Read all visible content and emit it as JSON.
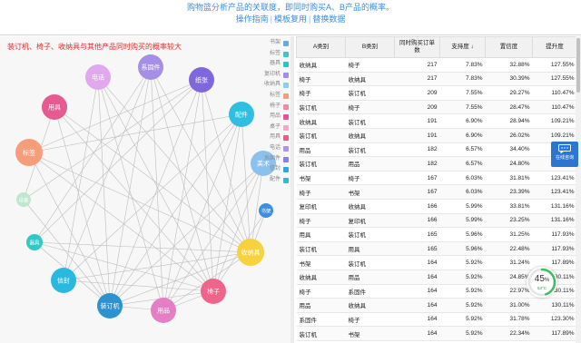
{
  "header": {
    "description": "购物篮分析产品的关联度，即同时购买A、B产品的概率。",
    "links": [
      "操作指南",
      "模板复用",
      "替换数据"
    ]
  },
  "chart": {
    "title": "装订机、椅子、收纳具与其他产品同时购买的概率较大",
    "legend": [
      {
        "label": "书架",
        "color": "#6aa7e8"
      },
      {
        "label": "标签",
        "color": "#3fc6c8"
      },
      {
        "label": "器具",
        "color": "#30c2c9"
      },
      {
        "label": "复印机",
        "color": "#a08ee8"
      },
      {
        "label": "收纳具",
        "color": "#8ad0e8"
      },
      {
        "label": "标签",
        "color": "#f79d7b"
      },
      {
        "label": "椅子",
        "color": "#f08aa0"
      },
      {
        "label": "用品",
        "color": "#e3559b"
      },
      {
        "label": "桌子",
        "color": "#f7a8c8"
      },
      {
        "label": "用具",
        "color": "#e95b8c"
      },
      {
        "label": "电话",
        "color": "#b691e8"
      },
      {
        "label": "系固件",
        "color": "#8a7ee6"
      },
      {
        "label": "信封",
        "color": "#2fa7d9"
      },
      {
        "label": "配件",
        "color": "#3bb5d6"
      }
    ],
    "nodes": [
      {
        "id": "电话",
        "color": "#e1a8ef"
      },
      {
        "id": "系固件",
        "color": "#a58fe6"
      },
      {
        "id": "纸张",
        "color": "#7e68dc"
      },
      {
        "id": "用具",
        "color": "#e55a91"
      },
      {
        "id": "配件",
        "color": "#2fbfe0"
      },
      {
        "id": "标签",
        "color": "#f69d7b"
      },
      {
        "id": "美术",
        "color": "#8cc1ee"
      },
      {
        "id": "设备",
        "color": "#bfe6cf"
      },
      {
        "id": "书架",
        "color": "#3d8ee0"
      },
      {
        "id": "器具",
        "color": "#2fc9c8"
      },
      {
        "id": "收纳具",
        "color": "#f7d23e"
      },
      {
        "id": "信封",
        "color": "#2ab9de"
      },
      {
        "id": "椅子",
        "color": "#f0648a"
      },
      {
        "id": "装订机",
        "color": "#2c93d0"
      },
      {
        "id": "用品",
        "color": "#e67ec6"
      }
    ],
    "links": [
      [
        "装订机",
        "电话"
      ],
      [
        "装订机",
        "系固件"
      ],
      [
        "装订机",
        "纸张"
      ],
      [
        "装订机",
        "配件"
      ],
      [
        "装订机",
        "用具"
      ],
      [
        "装订机",
        "标签"
      ],
      [
        "装订机",
        "美术"
      ],
      [
        "装订机",
        "收纳具"
      ],
      [
        "装订机",
        "椅子"
      ],
      [
        "装订机",
        "用品"
      ],
      [
        "装订机",
        "器具"
      ],
      [
        "装订机",
        "设备"
      ],
      [
        "椅子",
        "电话"
      ],
      [
        "椅子",
        "系固件"
      ],
      [
        "椅子",
        "纸张"
      ],
      [
        "椅子",
        "配件"
      ],
      [
        "椅子",
        "用具"
      ],
      [
        "椅子",
        "标签"
      ],
      [
        "椅子",
        "书架"
      ],
      [
        "椅子",
        "美术"
      ],
      [
        "椅子",
        "器具"
      ],
      [
        "椅子",
        "信封"
      ],
      [
        "椅子",
        "用品"
      ],
      [
        "收纳具",
        "电话"
      ],
      [
        "收纳具",
        "系固件"
      ],
      [
        "收纳具",
        "纸张"
      ],
      [
        "收纳具",
        "配件"
      ],
      [
        "收纳具",
        "用具"
      ],
      [
        "收纳具",
        "标签"
      ],
      [
        "收纳具",
        "书架"
      ],
      [
        "收纳具",
        "美术"
      ],
      [
        "收纳具",
        "器具"
      ],
      [
        "收纳具",
        "信封"
      ],
      [
        "收纳具",
        "用品"
      ],
      [
        "用品",
        "电话"
      ],
      [
        "用品",
        "系固件"
      ],
      [
        "用品",
        "配件"
      ],
      [
        "用品",
        "纸张"
      ],
      [
        "用品",
        "美术"
      ],
      [
        "信封",
        "电话"
      ],
      [
        "信封",
        "系固件"
      ],
      [
        "信封",
        "配件"
      ],
      [
        "器具",
        "系固件"
      ],
      [
        "器具",
        "纸张"
      ],
      [
        "设备",
        "用具"
      ],
      [
        "设备",
        "纸张"
      ],
      [
        "标签",
        "纸张"
      ],
      [
        "标签",
        "配件"
      ]
    ]
  },
  "table": {
    "columns": [
      "A类别",
      "B类别",
      "同时购买订单数",
      "支持度 ↓",
      "置信度",
      "提升度"
    ],
    "rows": [
      [
        "收纳具",
        "椅子",
        "217",
        "7.83%",
        "32.88%",
        "127.55%"
      ],
      [
        "椅子",
        "收纳具",
        "217",
        "7.83%",
        "30.39%",
        "127.55%"
      ],
      [
        "椅子",
        "装订机",
        "209",
        "7.55%",
        "29.27%",
        "110.47%"
      ],
      [
        "装订机",
        "椅子",
        "209",
        "7.55%",
        "28.47%",
        "110.47%"
      ],
      [
        "收纳具",
        "装订机",
        "191",
        "6.90%",
        "28.94%",
        "109.21%"
      ],
      [
        "装订机",
        "收纳具",
        "191",
        "6.90%",
        "26.02%",
        "109.21%"
      ],
      [
        "用品",
        "装订机",
        "182",
        "6.57%",
        "34.40%",
        "129.82%"
      ],
      [
        "装订机",
        "用品",
        "182",
        "6.57%",
        "24.80%",
        "129.82%"
      ],
      [
        "书架",
        "椅子",
        "167",
        "6.03%",
        "31.81%",
        "123.41%"
      ],
      [
        "椅子",
        "书架",
        "167",
        "6.03%",
        "23.39%",
        "123.41%"
      ],
      [
        "复印机",
        "收纳具",
        "166",
        "5.99%",
        "33.81%",
        "131.16%"
      ],
      [
        "椅子",
        "复印机",
        "166",
        "5.99%",
        "23.25%",
        "131.16%"
      ],
      [
        "用具",
        "装订机",
        "165",
        "5.96%",
        "31.25%",
        "117.93%"
      ],
      [
        "装订机",
        "用具",
        "165",
        "5.96%",
        "22.48%",
        "117.93%"
      ],
      [
        "书架",
        "装订机",
        "164",
        "5.92%",
        "31.24%",
        "117.89%"
      ],
      [
        "收纳具",
        "用品",
        "164",
        "5.92%",
        "24.85%",
        "130.11%"
      ],
      [
        "椅子",
        "系固件",
        "164",
        "5.92%",
        "22.97%",
        "130.11%"
      ],
      [
        "用品",
        "收纳具",
        "164",
        "5.92%",
        "31.00%",
        "130.11%"
      ],
      [
        "系固件",
        "椅子",
        "164",
        "5.92%",
        "31.78%",
        "123.30%"
      ],
      [
        "装订机",
        "书架",
        "164",
        "5.92%",
        "22.34%",
        "117.89%"
      ]
    ]
  },
  "widgets": {
    "chat_label": "在线咨询",
    "gauge_percent": "45",
    "gauge_unit": "%",
    "gauge_speed": "53°C"
  }
}
